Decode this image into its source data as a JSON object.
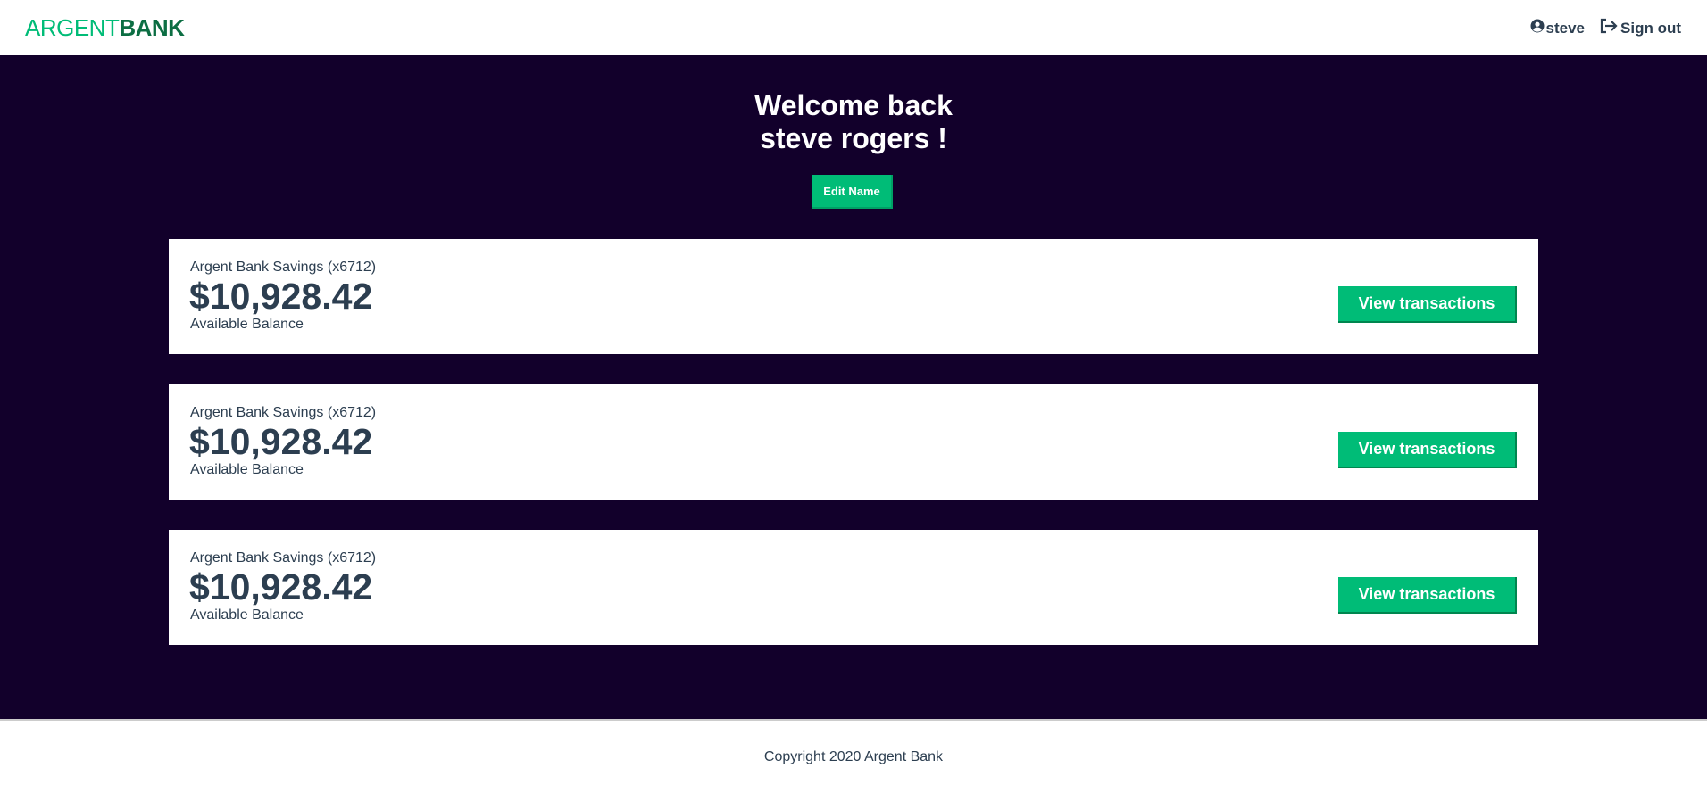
{
  "header": {
    "logo_part1": "ARGENT",
    "logo_part2": "BANK",
    "user_name": "steve",
    "sign_out_label": "Sign out",
    "user_icon": "user-circle-icon",
    "sign_out_icon": "sign-out-icon"
  },
  "welcome": {
    "line1": "Welcome back",
    "line2": "steve rogers !",
    "edit_button_label": "Edit Name"
  },
  "accounts": [
    {
      "title": "Argent Bank Savings (x6712)",
      "amount": "$10,928.42",
      "description": "Available Balance",
      "button_label": "View transactions"
    },
    {
      "title": "Argent Bank Savings (x6712)",
      "amount": "$10,928.42",
      "description": "Available Balance",
      "button_label": "View transactions"
    },
    {
      "title": "Argent Bank Savings (x6712)",
      "amount": "$10,928.42",
      "description": "Available Balance",
      "button_label": "View transactions"
    }
  ],
  "footer": {
    "copyright": "Copyright 2020 Argent Bank"
  },
  "colors": {
    "brand_green": "#00bc77",
    "brand_dark_green": "#0c6e43",
    "background_dark": "#12002b",
    "text_dark": "#2c3e50"
  }
}
